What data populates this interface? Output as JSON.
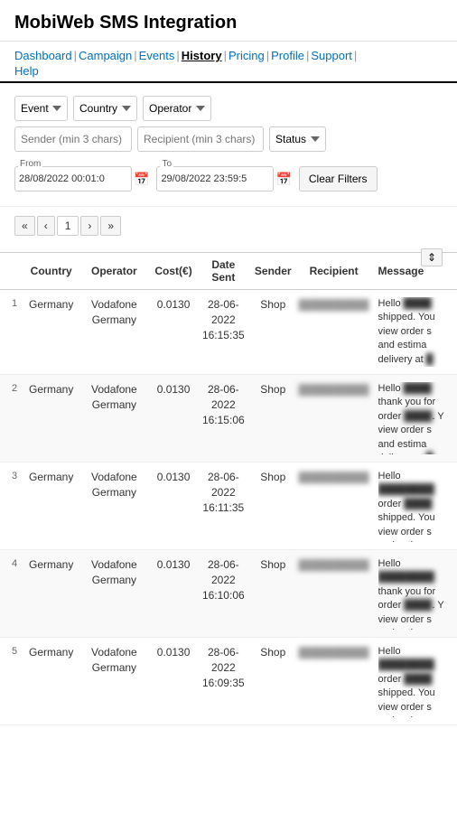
{
  "header": {
    "title": "MobiWeb SMS Integration"
  },
  "nav": {
    "items": [
      {
        "label": "Dashboard",
        "active": false
      },
      {
        "label": "Campaign",
        "active": false
      },
      {
        "label": "Events",
        "active": false
      },
      {
        "label": "History",
        "active": true
      },
      {
        "label": "Pricing",
        "active": false
      },
      {
        "label": "Profile",
        "active": false
      },
      {
        "label": "Support",
        "active": false
      }
    ],
    "row2": [
      {
        "label": "Help",
        "active": false
      }
    ]
  },
  "filters": {
    "event_placeholder": "Event",
    "country_placeholder": "Country",
    "operator_placeholder": "Operator",
    "sender_placeholder": "Sender (min 3 chars)",
    "recipient_placeholder": "Recipient (min 3 chars)",
    "status_placeholder": "Status",
    "from_label": "From",
    "from_value": "28/08/2022 00:01:0",
    "to_label": "To",
    "to_value": "29/08/2022 23:59:5",
    "clear_label": "Clear Filters"
  },
  "pagination": {
    "first": "«",
    "prev": "‹",
    "current": "1",
    "next": "›",
    "last": "»"
  },
  "table": {
    "sort_icon": "⇕",
    "columns": [
      "",
      "Country",
      "Operator",
      "Cost(€)",
      "Date Sent",
      "Sender",
      "Recipient",
      "Message"
    ],
    "rows": [
      {
        "num": "1",
        "country": "Germany",
        "operator": "Vodafone Germany",
        "cost": "0.0130",
        "date": "28-06-2022 16:15:35",
        "sender": "Shop",
        "recipient": "XXXXXXXXXX",
        "message": "Hello XXXX-X shipped. You view order s and estima delivery at X"
      },
      {
        "num": "2",
        "country": "Germany",
        "operator": "Vodafone Germany",
        "cost": "0.0130",
        "date": "28-06-2022 16:15:06",
        "sender": "Shop",
        "recipient": "XXXXXXXXXX",
        "message": "Hello XXXX thank you for order XXXX. Y view order s and estima delivery at X"
      },
      {
        "num": "3",
        "country": "Germany",
        "operator": "Vodafone Germany",
        "cost": "0.0130",
        "date": "28-06-2022 16:11:35",
        "sender": "Shop",
        "recipient": "XXXXXXXXXX",
        "message": "Hello XXXXXXXX order XXXX shipped. You view order s and estima delivery at X"
      },
      {
        "num": "4",
        "country": "Germany",
        "operator": "Vodafone Germany",
        "cost": "0.0130",
        "date": "28-06-2022 16:10:06",
        "sender": "Shop",
        "recipient": "XXXXXXXXXX",
        "message": "Hello XXXXXXXX thank you for order XXXX. Y view order s and estima delivery at X"
      },
      {
        "num": "5",
        "country": "Germany",
        "operator": "Vodafone Germany",
        "cost": "0.0130",
        "date": "28-06-2022 16:09:35",
        "sender": "Shop",
        "recipient": "XXXXXXXXXX",
        "message": "Hello XXXXXXXX order XXXX shipped. You view order s and estima delivery at X"
      }
    ]
  }
}
